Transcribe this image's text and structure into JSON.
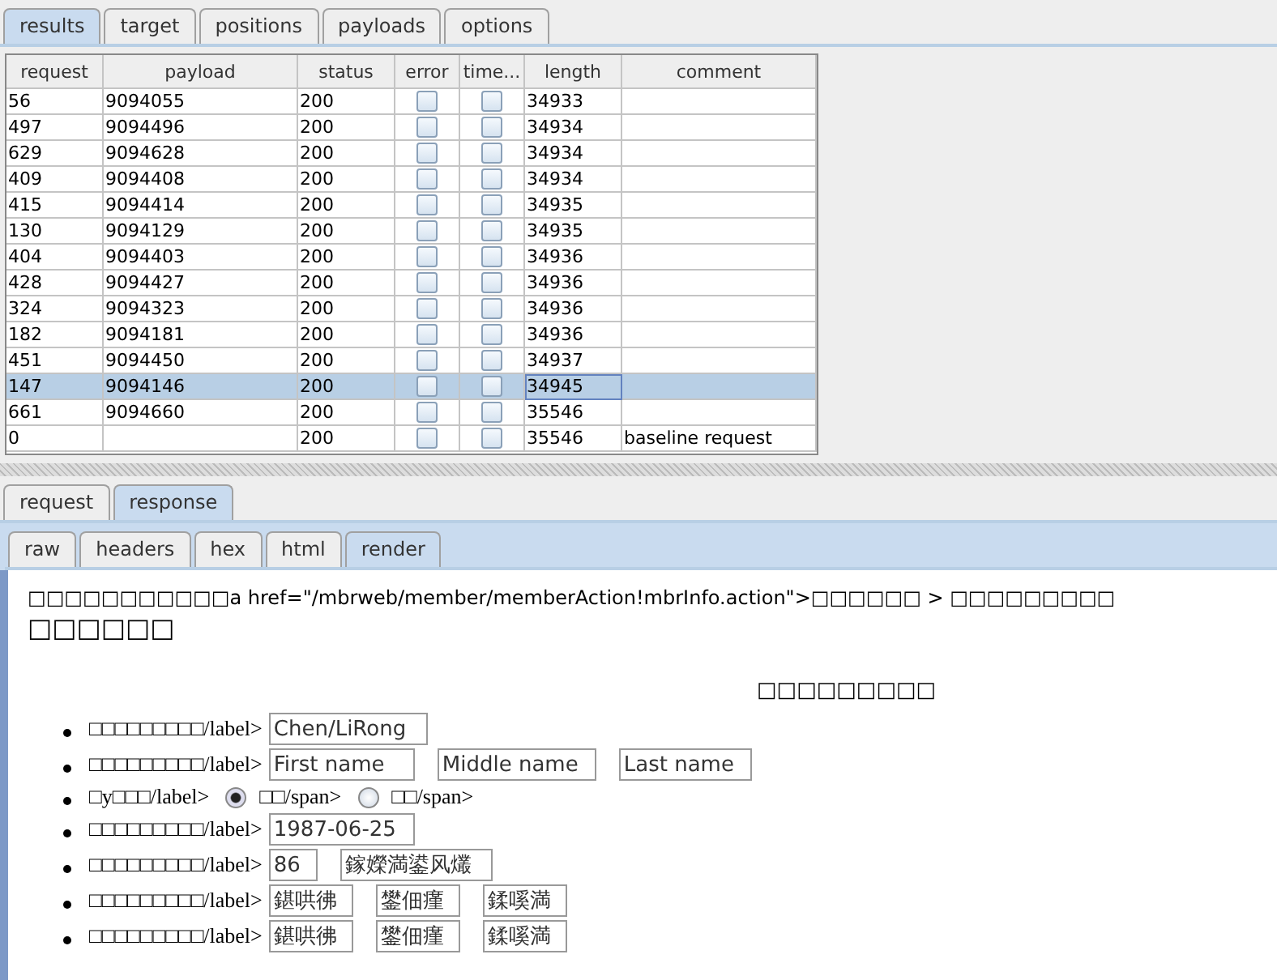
{
  "tabs": [
    {
      "label": "results",
      "selected": true
    },
    {
      "label": "target",
      "selected": false
    },
    {
      "label": "positions",
      "selected": false
    },
    {
      "label": "payloads",
      "selected": false
    },
    {
      "label": "options",
      "selected": false
    }
  ],
  "table": {
    "columns": [
      "request",
      "payload",
      "status",
      "error",
      "time...",
      "length",
      "comment"
    ],
    "rows": [
      {
        "request": "56",
        "payload": "9094055",
        "status": "200",
        "error": false,
        "timeout": false,
        "length": "34933",
        "comment": "",
        "selected": false
      },
      {
        "request": "497",
        "payload": "9094496",
        "status": "200",
        "error": false,
        "timeout": false,
        "length": "34934",
        "comment": "",
        "selected": false
      },
      {
        "request": "629",
        "payload": "9094628",
        "status": "200",
        "error": false,
        "timeout": false,
        "length": "34934",
        "comment": "",
        "selected": false
      },
      {
        "request": "409",
        "payload": "9094408",
        "status": "200",
        "error": false,
        "timeout": false,
        "length": "34934",
        "comment": "",
        "selected": false
      },
      {
        "request": "415",
        "payload": "9094414",
        "status": "200",
        "error": false,
        "timeout": false,
        "length": "34935",
        "comment": "",
        "selected": false
      },
      {
        "request": "130",
        "payload": "9094129",
        "status": "200",
        "error": false,
        "timeout": false,
        "length": "34935",
        "comment": "",
        "selected": false
      },
      {
        "request": "404",
        "payload": "9094403",
        "status": "200",
        "error": false,
        "timeout": false,
        "length": "34936",
        "comment": "",
        "selected": false
      },
      {
        "request": "428",
        "payload": "9094427",
        "status": "200",
        "error": false,
        "timeout": false,
        "length": "34936",
        "comment": "",
        "selected": false
      },
      {
        "request": "324",
        "payload": "9094323",
        "status": "200",
        "error": false,
        "timeout": false,
        "length": "34936",
        "comment": "",
        "selected": false
      },
      {
        "request": "182",
        "payload": "9094181",
        "status": "200",
        "error": false,
        "timeout": false,
        "length": "34936",
        "comment": "",
        "selected": false
      },
      {
        "request": "451",
        "payload": "9094450",
        "status": "200",
        "error": false,
        "timeout": false,
        "length": "34937",
        "comment": "",
        "selected": false
      },
      {
        "request": "147",
        "payload": "9094146",
        "status": "200",
        "error": false,
        "timeout": false,
        "length": "34945",
        "comment": "",
        "selected": true
      },
      {
        "request": "661",
        "payload": "9094660",
        "status": "200",
        "error": false,
        "timeout": false,
        "length": "35546",
        "comment": "",
        "selected": false
      },
      {
        "request": "0",
        "payload": "",
        "status": "200",
        "error": false,
        "timeout": false,
        "length": "35546",
        "comment": "baseline request",
        "selected": false
      }
    ]
  },
  "message_tabs": [
    {
      "label": "request",
      "selected": false
    },
    {
      "label": "response",
      "selected": true
    }
  ],
  "view_tabs": [
    {
      "label": "raw",
      "selected": false
    },
    {
      "label": "headers",
      "selected": false
    },
    {
      "label": "hex",
      "selected": false
    },
    {
      "label": "html",
      "selected": false
    },
    {
      "label": "render",
      "selected": true
    }
  ],
  "render": {
    "breadcrumb": "□□□□□□□□□□□a href=\"/mbrweb/member/memberAction!mbrInfo.action\">□□□□□□ > □□□□□□□□□",
    "title": "□□□□□□",
    "heading": "□□□□□□□□□",
    "items": [
      {
        "label": "□□□□□□□□□/label>",
        "kind": "fields",
        "fields": [
          {
            "value": "Chen/LiRong"
          }
        ]
      },
      {
        "label": "□□□□□□□□□/label>",
        "kind": "fields",
        "fields": [
          {
            "placeholder": "First name"
          },
          {
            "placeholder": "Middle name"
          },
          {
            "placeholder": "Last name"
          }
        ]
      },
      {
        "label": "□y□□□/label>",
        "kind": "radios",
        "options": [
          {
            "label": "□□/span>",
            "selected": true
          },
          {
            "label": "□□/span>",
            "selected": false
          }
        ]
      },
      {
        "label": "□□□□□□□□□/label>",
        "kind": "fields",
        "fields": [
          {
            "value": "1987-06-25"
          }
        ]
      },
      {
        "label": "□□□□□□□□□/label>",
        "kind": "fields",
        "fields": [
          {
            "value": "86"
          },
          {
            "value": "鎵嬫満鍙风爜"
          }
        ]
      },
      {
        "label": "□□□□□□□□□/label>",
        "kind": "fields",
        "fields": [
          {
            "value": "鍖哄彿"
          },
          {
            "value": "鐢佃瘽"
          },
          {
            "value": "鍒嗘満"
          }
        ]
      },
      {
        "label": "□□□□□□□□□/label>",
        "kind": "fields",
        "fields": [
          {
            "value": "鍖哄彿"
          },
          {
            "value": "鐢佃瘽"
          },
          {
            "value": "鍒嗘満"
          }
        ]
      }
    ]
  }
}
